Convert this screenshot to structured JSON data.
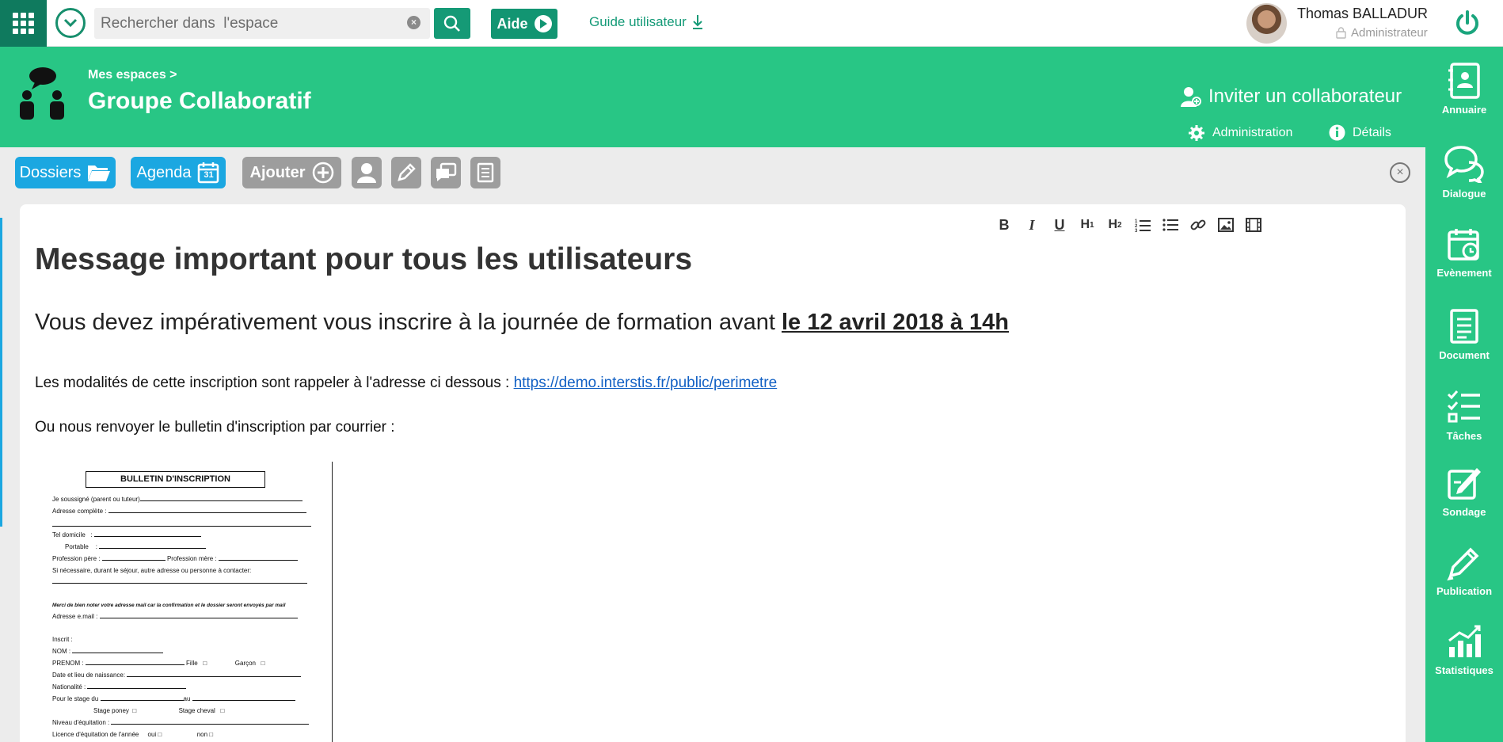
{
  "topbar": {
    "search_placeholder": "Rechercher dans  l'espace",
    "aide_label": "Aide",
    "guide_label": "Guide utilisateur",
    "user_name": "Thomas BALLADUR",
    "user_role": "Administrateur"
  },
  "header": {
    "breadcrumb": "Mes espaces >",
    "title": "Groupe Collaboratif",
    "invite_label": "Inviter un collaborateur",
    "administration_label": "Administration",
    "details_label": "Détails"
  },
  "sidebar": {
    "items": [
      {
        "label": "Annuaire",
        "icon": "directory-icon"
      },
      {
        "label": "Dialogue",
        "icon": "chat-icon"
      },
      {
        "label": "Evènement",
        "icon": "calendar-event-icon"
      },
      {
        "label": "Document",
        "icon": "document-icon"
      },
      {
        "label": "Tâches",
        "icon": "tasks-icon"
      },
      {
        "label": "Sondage",
        "icon": "survey-icon"
      },
      {
        "label": "Publication",
        "icon": "pencil-icon"
      },
      {
        "label": "Statistiques",
        "icon": "stats-icon"
      }
    ]
  },
  "toolbar": {
    "dossiers_label": "Dossiers",
    "agenda_label": "Agenda",
    "agenda_day": "31",
    "ajouter_label": "Ajouter"
  },
  "format_toolbar": {
    "buttons": [
      "B",
      "I",
      "U",
      "H1",
      "H2",
      "ordered-list",
      "bullet-list",
      "link",
      "image",
      "video"
    ]
  },
  "content": {
    "heading": "Message important pour tous les utilisateurs",
    "lead_text": "Vous devez impérativement vous inscrire à la journée de formation avant ",
    "lead_bold": "le 12 avril 2018 à 14h",
    "p1_text": "Les modalités de cette inscription sont rappeler à l'adresse ci dessous : ",
    "p1_link": "https://demo.interstis.fr/public/perimetre",
    "p2_text": "Ou nous renvoyer le bulletin d'inscription par courrier :"
  },
  "bulletin": {
    "title": "BULLETIN D'INSCRIPTION",
    "line1": "Je soussigné (parent ou tuteur)",
    "line2": "Adresse complète :",
    "line3": "Tel domicile",
    "line4": "Portable",
    "line5a": "Profession père :",
    "line5b": "Profession mère :",
    "line6": "Si nécessaire, durant le séjour, autre adresse ou personne à contacter:",
    "note": "Merci de bien noter votre adresse mail car la confirmation et le dossier seront envoyés par mail",
    "email": "Adresse e.mail :",
    "inscrit": "Inscrit :",
    "nom": "NOM :",
    "prenom": "PRENOM :",
    "fille": "Fille",
    "garcon": "Garçon",
    "date_lieu": "Date et lieu de naissance:",
    "nationalite": "Nationalité :",
    "stage_du": "Pour le stage du",
    "au": "au",
    "stage_poney": "Stage poney",
    "stage_cheval": "Stage cheval",
    "niveau": "Niveau d'équitation :",
    "licence": "Licence d'équitation de l'année",
    "oui": "oui",
    "non": "non"
  }
}
